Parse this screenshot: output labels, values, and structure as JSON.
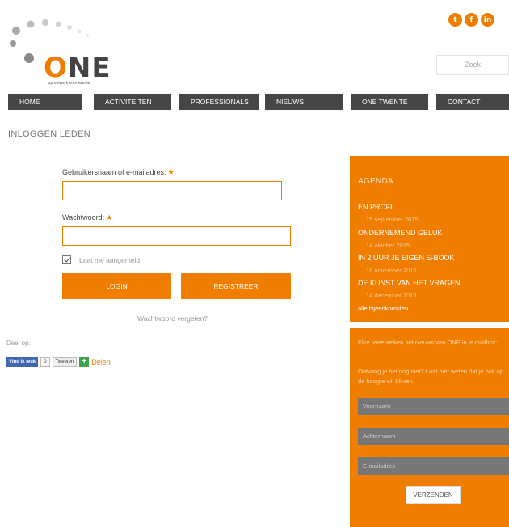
{
  "brand": {
    "logo_word": "NE",
    "logo_letter": "O",
    "tagline": "zp netwerk voor twente",
    "accent_color": "#ef7d00"
  },
  "social": [
    {
      "name": "twitter-icon",
      "glyph": "t"
    },
    {
      "name": "facebook-icon",
      "glyph": "f"
    },
    {
      "name": "linkedin-icon",
      "glyph": "in"
    }
  ],
  "search": {
    "placeholder": "Zoek"
  },
  "nav": [
    {
      "label": "HOME"
    },
    {
      "label": "ACTIVITEITEN"
    },
    {
      "label": "PROFESSIONALS"
    },
    {
      "label": "NIEUWS"
    },
    {
      "label": "ONE TWENTE"
    },
    {
      "label": "CONTACT"
    }
  ],
  "page": {
    "title": "INLOGGEN LEDEN"
  },
  "login": {
    "username_label": "Gebruikersnaam of e-mailadres:",
    "password_label": "Wachtwoord:",
    "required_mark": "★",
    "remember_label": "Laat me aangemeld",
    "login_button": "LOGIN",
    "register_button": "REGISTREER",
    "forgot_link": "Wachtwoord vergeten?"
  },
  "share": {
    "label": "Deel op:",
    "fb_like": "Vind ik leuk",
    "tweet_count": "0",
    "tweet_button": "Tweeten",
    "share_link": "Delen"
  },
  "agenda": {
    "title": "AGENDA",
    "events": [
      {
        "title": "EN PROFIL",
        "date": "15 september 2015"
      },
      {
        "title": "ONDERNEMEND GELUK",
        "date": "14 oktober 2015"
      },
      {
        "title": "IN 2 UUR JE EIGEN E-BOOK",
        "date": "18 november 2015"
      },
      {
        "title": "DE KUNST VAN HET VRAGEN",
        "date": "14 december 2015"
      }
    ],
    "all_link": "alle bijeenkomsten"
  },
  "newsletter": {
    "intro": "Elke twee weken het nieuws van ONE in je mailbox:",
    "text": "Ontvang je het nog niet? Laat hier weten dat je ook op de hoogte wil blijven.",
    "first_name_placeholder": "Voornaam",
    "last_name_placeholder": "Achternaam",
    "email_placeholder": "E-mailadres",
    "submit": "VERZENDEN"
  }
}
